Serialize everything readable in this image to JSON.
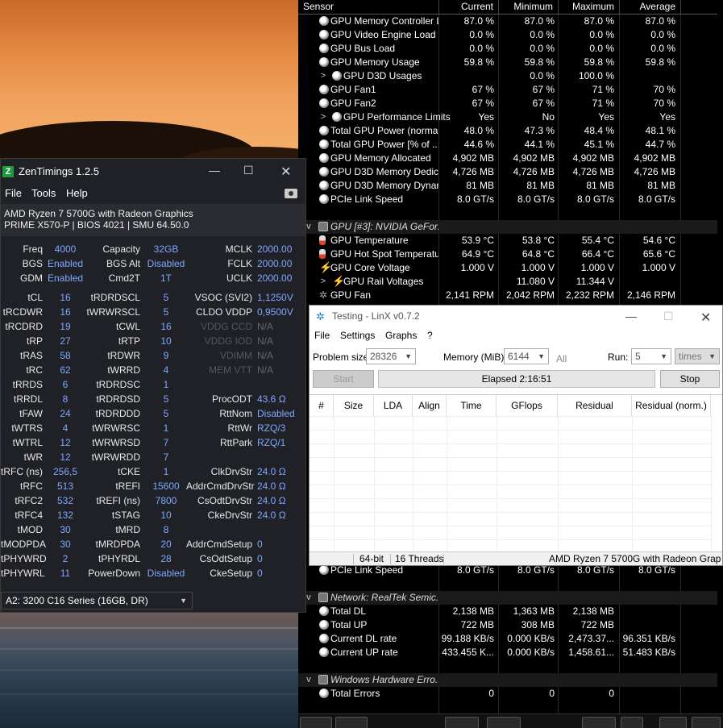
{
  "hwinfo": {
    "columns": [
      "Sensor",
      "Current",
      "Minimum",
      "Maximum",
      "Average"
    ],
    "rows": [
      {
        "icon": "circle",
        "indent": 0,
        "name": "GPU Memory Controller L...",
        "cur": "87.0 %",
        "min": "87.0 %",
        "max": "87.0 %",
        "avg": "87.0 %"
      },
      {
        "icon": "circle",
        "indent": 0,
        "name": "GPU Video Engine Load",
        "cur": "0.0 %",
        "min": "0.0 %",
        "max": "0.0 %",
        "avg": "0.0 %"
      },
      {
        "icon": "circle",
        "indent": 0,
        "name": "GPU Bus Load",
        "cur": "0.0 %",
        "min": "0.0 %",
        "max": "0.0 %",
        "avg": "0.0 %"
      },
      {
        "icon": "circle",
        "indent": 0,
        "name": "GPU Memory Usage",
        "cur": "59.8 %",
        "min": "59.8 %",
        "max": "59.8 %",
        "avg": "59.8 %"
      },
      {
        "icon": "circle",
        "indent": 1,
        "exp": ">",
        "name": "GPU D3D Usages",
        "cur": "",
        "min": "0.0 %",
        "max": "100.0 %",
        "avg": ""
      },
      {
        "icon": "circle",
        "indent": 0,
        "name": "GPU Fan1",
        "cur": "67 %",
        "min": "67 %",
        "max": "71 %",
        "avg": "70 %"
      },
      {
        "icon": "circle",
        "indent": 0,
        "name": "GPU Fan2",
        "cur": "67 %",
        "min": "67 %",
        "max": "71 %",
        "avg": "70 %"
      },
      {
        "icon": "circle",
        "indent": 1,
        "exp": ">",
        "name": "GPU Performance Limits",
        "cur": "Yes",
        "min": "No",
        "max": "Yes",
        "avg": "Yes"
      },
      {
        "icon": "circle",
        "indent": 0,
        "name": "Total GPU Power (normal...",
        "cur": "48.0 %",
        "min": "47.3 %",
        "max": "48.4 %",
        "avg": "48.1 %"
      },
      {
        "icon": "circle",
        "indent": 0,
        "name": "Total GPU Power [% of ...",
        "cur": "44.6 %",
        "min": "44.1 %",
        "max": "45.1 %",
        "avg": "44.7 %"
      },
      {
        "icon": "circle",
        "indent": 0,
        "name": "GPU Memory Allocated",
        "cur": "4,902 MB",
        "min": "4,902 MB",
        "max": "4,902 MB",
        "avg": "4,902 MB"
      },
      {
        "icon": "circle",
        "indent": 0,
        "name": "GPU D3D Memory Dedica...",
        "cur": "4,726 MB",
        "min": "4,726 MB",
        "max": "4,726 MB",
        "avg": "4,726 MB"
      },
      {
        "icon": "circle",
        "indent": 0,
        "name": "GPU D3D Memory Dynamic",
        "cur": "81 MB",
        "min": "81 MB",
        "max": "81 MB",
        "avg": "81 MB"
      },
      {
        "icon": "circle",
        "indent": 0,
        "name": "PCIe Link Speed",
        "cur": "8.0 GT/s",
        "min": "8.0 GT/s",
        "max": "8.0 GT/s",
        "avg": "8.0 GT/s"
      },
      {
        "type": "blank"
      },
      {
        "type": "group",
        "icon": "chip",
        "exp": "v",
        "name": "GPU [#3]: NVIDIA GeFor..."
      },
      {
        "icon": "thermo",
        "indent": 0,
        "name": "GPU Temperature",
        "cur": "53.9 °C",
        "min": "53.8 °C",
        "max": "55.4 °C",
        "avg": "54.6 °C"
      },
      {
        "icon": "thermo",
        "indent": 0,
        "name": "GPU Hot Spot Temperature",
        "cur": "64.9 °C",
        "min": "64.8 °C",
        "max": "66.4 °C",
        "avg": "65.6 °C"
      },
      {
        "icon": "bolt",
        "indent": 0,
        "name": "GPU Core Voltage",
        "cur": "1.000 V",
        "min": "1.000 V",
        "max": "1.000 V",
        "avg": "1.000 V"
      },
      {
        "icon": "bolt",
        "indent": 1,
        "exp": ">",
        "name": "GPU Rail Voltages",
        "cur": "",
        "min": "11.080 V",
        "max": "11.344 V",
        "avg": ""
      },
      {
        "icon": "fan",
        "indent": 0,
        "name": "GPU Fan",
        "cur": "2,141 RPM",
        "min": "2,042 RPM",
        "max": "2,232 RPM",
        "avg": "2,146 RPM"
      }
    ],
    "rows_bottom": [
      {
        "icon": "circle",
        "indent": 0,
        "name": "PCIe Link Speed",
        "cur": "8.0 GT/s",
        "min": "8.0 GT/s",
        "max": "8.0 GT/s",
        "avg": "8.0 GT/s"
      },
      {
        "type": "blank"
      },
      {
        "type": "group",
        "icon": "chip",
        "exp": "v",
        "name": "Network: RealTek Semic..."
      },
      {
        "icon": "circle",
        "indent": 0,
        "name": "Total DL",
        "cur": "2,138 MB",
        "min": "1,363 MB",
        "max": "2,138 MB",
        "avg": ""
      },
      {
        "icon": "circle",
        "indent": 0,
        "name": "Total UP",
        "cur": "722 MB",
        "min": "308 MB",
        "max": "722 MB",
        "avg": ""
      },
      {
        "icon": "circle",
        "indent": 0,
        "name": "Current DL rate",
        "cur": "99.188 KB/s",
        "min": "0.000 KB/s",
        "max": "2,473.37...",
        "avg": "96.351 KB/s"
      },
      {
        "icon": "circle",
        "indent": 0,
        "name": "Current UP rate",
        "cur": "433.455 K...",
        "min": "0.000 KB/s",
        "max": "1,458.61...",
        "avg": "51.483 KB/s"
      },
      {
        "type": "blank"
      },
      {
        "type": "group",
        "icon": "chip",
        "exp": "v",
        "name": "Windows Hardware Erro..."
      },
      {
        "icon": "circle",
        "indent": 0,
        "name": "Total Errors",
        "cur": "0",
        "min": "0",
        "max": "0",
        "avg": ""
      }
    ]
  },
  "zentimings": {
    "title": "ZenTimings 1.2.5",
    "logo": "Z",
    "menu": [
      "File",
      "Tools",
      "Help"
    ],
    "cpu": "AMD Ryzen 7 5700G with Radeon Graphics",
    "board": "PRIME X570-P | BIOS 4021 | SMU 64.50.0",
    "top": [
      [
        "Freq",
        "4000",
        "Capacity",
        "32GB",
        "MCLK",
        "2000.00"
      ],
      [
        "BGS",
        "Enabled",
        "BGS Alt",
        "Disabled",
        "FCLK",
        "2000.00"
      ],
      [
        "GDM",
        "Enabled",
        "Cmd2T",
        "1T",
        "UCLK",
        "2000.00"
      ]
    ],
    "timings": [
      [
        "tCL",
        "16",
        "tRDRDSCL",
        "5",
        "VSOC (SVI2)",
        "1,1250V"
      ],
      [
        "tRCDWR",
        "16",
        "tWRWRSCL",
        "5",
        "CLDO VDDP",
        "0,9500V"
      ],
      [
        "tRCDRD",
        "19",
        "tCWL",
        "16",
        "VDDG CCD",
        "N/A"
      ],
      [
        "tRP",
        "27",
        "tRTP",
        "10",
        "VDDG IOD",
        "N/A"
      ],
      [
        "tRAS",
        "58",
        "tRDWR",
        "9",
        "VDIMM",
        "N/A"
      ],
      [
        "tRC",
        "62",
        "tWRRD",
        "4",
        "MEM VTT",
        "N/A"
      ],
      [
        "tRRDS",
        "6",
        "tRDRDSC",
        "1",
        "",
        ""
      ],
      [
        "tRRDL",
        "8",
        "tRDRDSD",
        "5",
        "ProcODT",
        "43.6 Ω"
      ],
      [
        "tFAW",
        "24",
        "tRDRDDD",
        "5",
        "RttNom",
        "Disabled"
      ],
      [
        "tWTRS",
        "4",
        "tWRWRSC",
        "1",
        "RttWr",
        "RZQ/3"
      ],
      [
        "tWTRL",
        "12",
        "tWRWRSD",
        "7",
        "RttPark",
        "RZQ/1"
      ],
      [
        "tWR",
        "12",
        "tWRWRDD",
        "7",
        "",
        ""
      ],
      [
        "tRFC (ns)",
        "256,5",
        "tCKE",
        "1",
        "ClkDrvStr",
        "24.0 Ω"
      ],
      [
        "tRFC",
        "513",
        "tREFI",
        "15600",
        "AddrCmdDrvStr",
        "24.0 Ω"
      ],
      [
        "tRFC2",
        "532",
        "tREFI (ns)",
        "7800",
        "CsOdtDrvStr",
        "24.0 Ω"
      ],
      [
        "tRFC4",
        "132",
        "tSTAG",
        "10",
        "CkeDrvStr",
        "24.0 Ω"
      ],
      [
        "tMOD",
        "30",
        "tMRD",
        "8",
        "",
        ""
      ],
      [
        "tMODPDA",
        "30",
        "tMRDPDA",
        "20",
        "AddrCmdSetup",
        "0"
      ],
      [
        "tPHYWRD",
        "2",
        "tPHYRDL",
        "28",
        "CsOdtSetup",
        "0"
      ],
      [
        "tPHYWRL",
        "11",
        "PowerDown",
        "Disabled",
        "CkeSetup",
        "0"
      ]
    ],
    "dimm_select": "A2: 3200 C16 Series (16GB, DR)"
  },
  "linx": {
    "title": "Testing - LinX v0.7.2",
    "menu": [
      "File",
      "Settings",
      "Graphs",
      "?"
    ],
    "problem_size_label": "Problem size:",
    "problem_size": "28326",
    "memory_label": "Memory (MiB):",
    "memory": "6144",
    "all_label": "All",
    "run_label": "Run:",
    "run": "5",
    "run_unit": "times",
    "start_label": "Start",
    "elapsed": "Elapsed 2:16:51",
    "stop_label": "Stop",
    "columns": [
      "#",
      "Size",
      "LDA",
      "Align",
      "Time",
      "GFlops",
      "Residual",
      "Residual (norm.)"
    ],
    "status": [
      "64-bit",
      "16 Threads",
      "AMD Ryzen 7 5700G with Radeon Grap"
    ]
  }
}
